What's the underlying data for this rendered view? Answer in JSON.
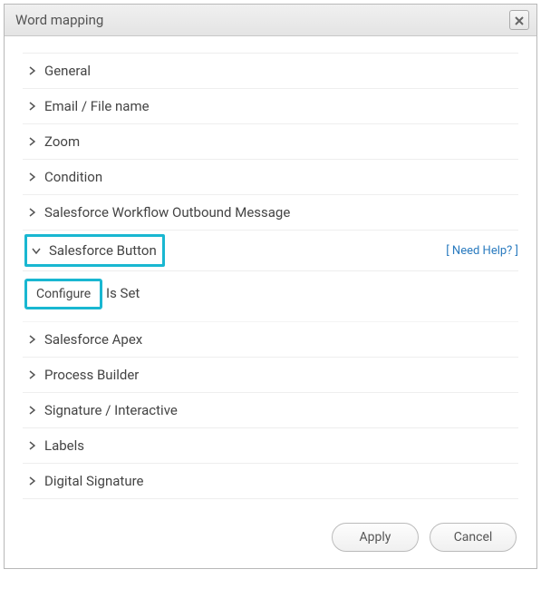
{
  "dialog": {
    "title": "Word mapping"
  },
  "sections": {
    "general": "General",
    "email": "Email / File name",
    "zoom": "Zoom",
    "condition": "Condition",
    "workflow": "Salesforce Workflow Outbound Message",
    "button": "Salesforce Button",
    "apex": "Salesforce Apex",
    "process": "Process Builder",
    "signature": "Signature / Interactive",
    "labels": "Labels",
    "digital": "Digital Signature"
  },
  "button_section": {
    "help": "[ Need Help? ]",
    "configure": "Configure",
    "status": "Is Set"
  },
  "footer": {
    "apply": "Apply",
    "cancel": "Cancel"
  }
}
